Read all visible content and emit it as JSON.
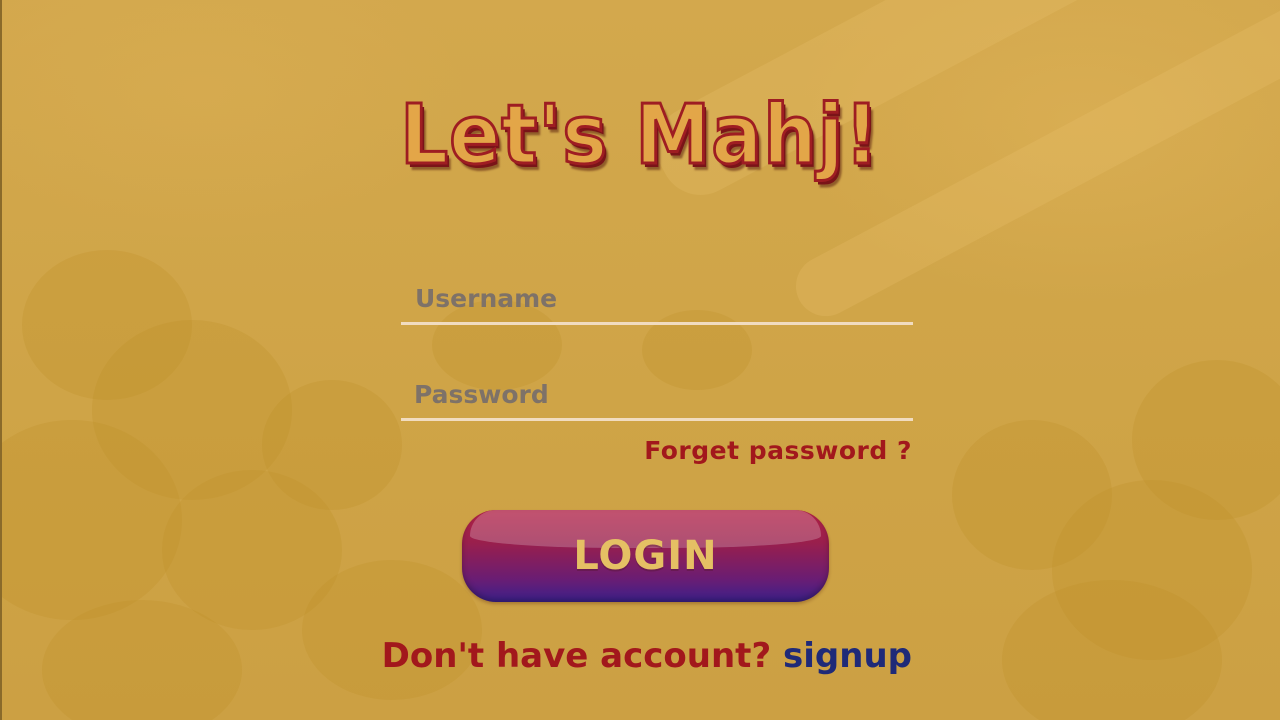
{
  "app": {
    "title": "Let's Mahj!"
  },
  "login_form": {
    "username_placeholder": "Username",
    "password_placeholder": "Password",
    "forgot_password_label": "Forget password ?",
    "login_button_label": "LOGIN",
    "signup_prompt": "Don't have account?",
    "signup_link_label": "signup"
  },
  "colors": {
    "background": "#d1a64a",
    "title_fill": "#e3a648",
    "title_outline": "#9e1d22",
    "accent_red": "#a2181c",
    "link_blue": "#1f2a78",
    "button_gradient_top": "#b22247",
    "button_gradient_bottom": "#3b208a",
    "button_text": "#e5c064",
    "input_underline": "#f1dcc0",
    "placeholder_text": "#7e7268"
  }
}
